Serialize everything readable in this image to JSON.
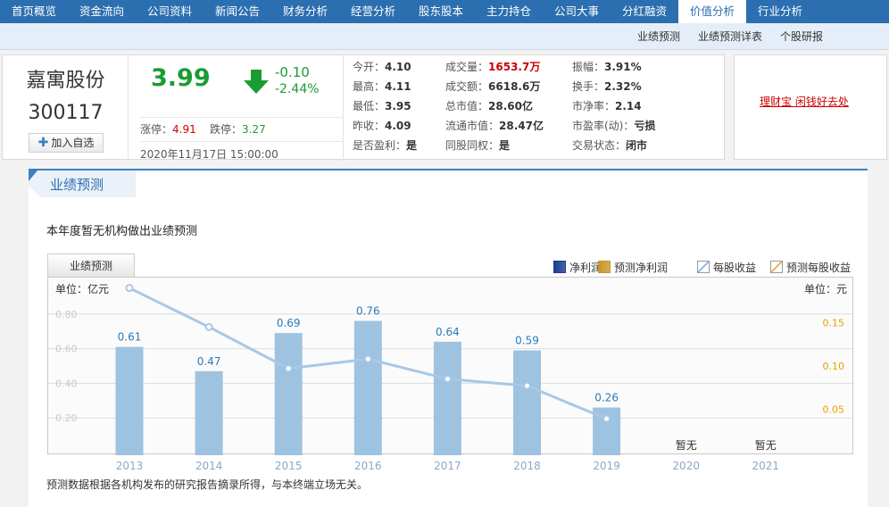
{
  "nav": {
    "tabs": [
      "首页概览",
      "资金流向",
      "公司资料",
      "新闻公告",
      "财务分析",
      "经营分析",
      "股东股本",
      "主力持仓",
      "公司大事",
      "分红融资",
      "价值分析",
      "行业分析"
    ],
    "active_index": 10
  },
  "subnav": {
    "items": [
      "业绩预测",
      "业绩预测详表",
      "个股研报"
    ]
  },
  "stock": {
    "name": "嘉寓股份",
    "code": "300117",
    "add_label": "加入自选",
    "price": "3.99",
    "change": "-0.10",
    "change_pct": "-2.44%",
    "limit_up_label": "涨停：",
    "limit_up": "4.91",
    "limit_down_label": "跌停：",
    "limit_down": "3.27",
    "time": "2020年11月17日 15:00:00"
  },
  "quote": {
    "col1": [
      {
        "label": "今开：",
        "value": "4.10"
      },
      {
        "label": "最高：",
        "value": "4.11"
      },
      {
        "label": "最低：",
        "value": "3.95"
      },
      {
        "label": "昨收：",
        "value": "4.09"
      },
      {
        "label": "是否盈利：",
        "value": "是"
      }
    ],
    "col2": [
      {
        "label": "成交量：",
        "value": "1653.7万"
      },
      {
        "label": "成交额：",
        "value": "6618.6万"
      },
      {
        "label": "总市值：",
        "value": "28.60亿"
      },
      {
        "label": "流通市值：",
        "value": "28.47亿"
      },
      {
        "label": "同股同权：",
        "value": "是"
      }
    ],
    "col3": [
      {
        "label": "振幅：",
        "value": "3.91%"
      },
      {
        "label": "换手：",
        "value": "2.32%"
      },
      {
        "label": "市净率：",
        "value": "2.14"
      },
      {
        "label": "市盈率(动)：",
        "value": "亏损"
      },
      {
        "label": "交易状态：",
        "value": "闭市"
      }
    ]
  },
  "ad": {
    "text": "理财宝 闲钱好去处"
  },
  "main": {
    "tab_title": "业绩预测",
    "notice": "本年度暂无机构做出业绩预测",
    "chart_tab": "业绩预测",
    "legend": [
      {
        "label": "净利润",
        "color": "#1a3d8f"
      },
      {
        "label": "预测净利润",
        "color": "#c8962a"
      },
      {
        "label": "每股收益",
        "color": "#8fb2d6"
      },
      {
        "label": "预测每股收益",
        "color": "#e8b040"
      }
    ],
    "footnote": "预测数据根据各机构发布的研究报告摘录所得，与本终端立场无关。"
  },
  "chart_data": {
    "type": "bar",
    "categories": [
      "2013",
      "2014",
      "2015",
      "2016",
      "2017",
      "2018",
      "2019",
      "2020",
      "2021"
    ],
    "series": [
      {
        "name": "净利润",
        "values": [
          0.61,
          0.47,
          0.69,
          0.76,
          0.64,
          0.59,
          0.26,
          null,
          null
        ],
        "color": "#9ec3e0"
      },
      {
        "name": "每股收益",
        "values": [
          0.19,
          0.145,
          0.097,
          0.108,
          0.085,
          0.077,
          0.039,
          null,
          null
        ],
        "color": "#a9c7e6"
      }
    ],
    "missing_label": "暂无",
    "left_unit": "单位：亿元",
    "right_unit": "单位：元",
    "left_ticks": [
      "0.20",
      "0.40",
      "0.60",
      "0.80"
    ],
    "right_ticks": [
      "0.05",
      "0.10",
      "0.15"
    ],
    "left_ylim": [
      0,
      1.0
    ],
    "right_ylim": [
      0,
      0.2
    ]
  }
}
